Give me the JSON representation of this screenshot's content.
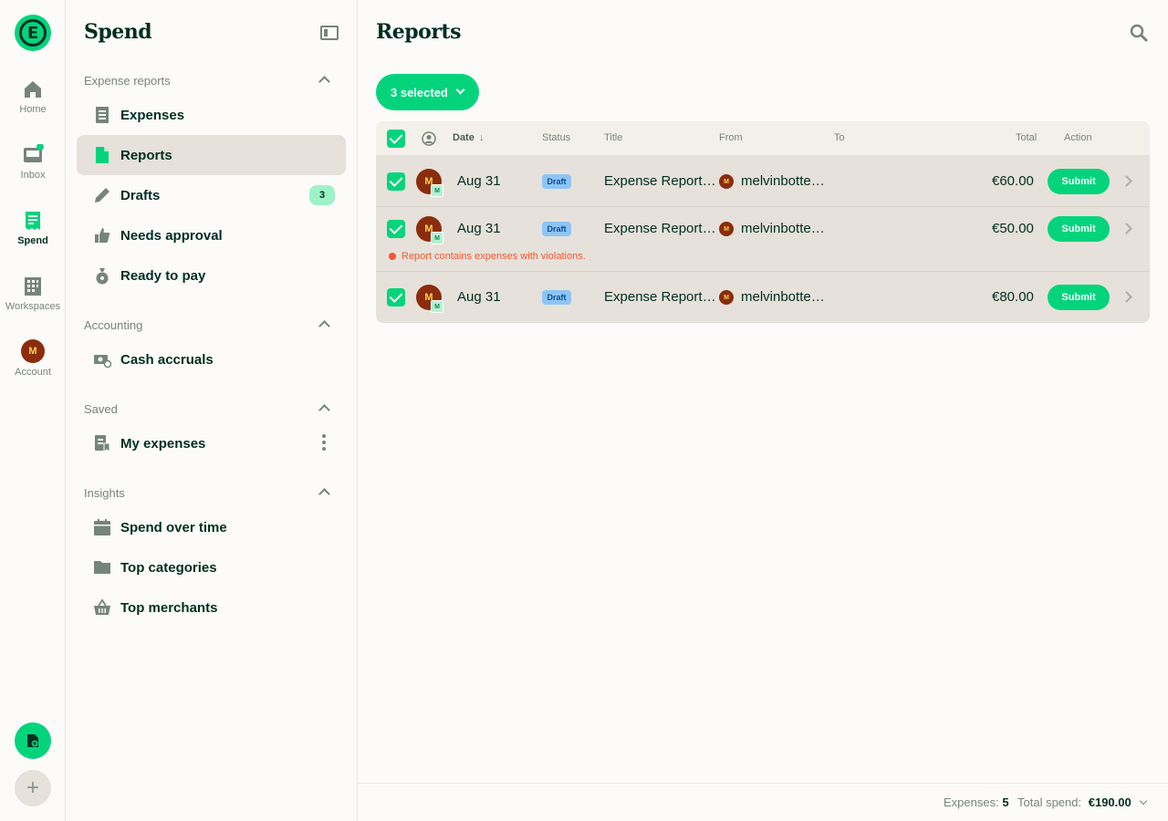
{
  "rail": {
    "items": [
      {
        "label": "Home",
        "icon": "home-icon"
      },
      {
        "label": "Inbox",
        "icon": "inbox-icon"
      },
      {
        "label": "Spend",
        "icon": "receipt-icon"
      },
      {
        "label": "Workspaces",
        "icon": "building-icon"
      },
      {
        "label": "Account",
        "icon": "avatar",
        "avatar_letter": "M"
      }
    ]
  },
  "sidebar": {
    "title": "Spend",
    "sections": [
      {
        "label": "Expense reports",
        "items": [
          {
            "label": "Expenses",
            "icon": "receipt-icon"
          },
          {
            "label": "Reports",
            "icon": "document-icon",
            "active": true
          },
          {
            "label": "Drafts",
            "icon": "pencil-icon",
            "badge": "3"
          },
          {
            "label": "Needs approval",
            "icon": "thumbs-up-icon"
          },
          {
            "label": "Ready to pay",
            "icon": "money-bag-icon"
          }
        ]
      },
      {
        "label": "Accounting",
        "items": [
          {
            "label": "Cash accruals",
            "icon": "cash-icon"
          }
        ]
      },
      {
        "label": "Saved",
        "items": [
          {
            "label": "My expenses",
            "icon": "bookmark-receipt-icon"
          }
        ]
      },
      {
        "label": "Insights",
        "items": [
          {
            "label": "Spend over time",
            "icon": "calendar-icon"
          },
          {
            "label": "Top categories",
            "icon": "folder-icon"
          },
          {
            "label": "Top merchants",
            "icon": "basket-icon"
          }
        ]
      }
    ]
  },
  "main": {
    "title": "Reports",
    "selected_button": "3 selected",
    "columns": {
      "date": "Date",
      "status": "Status",
      "title": "Title",
      "from": "From",
      "to": "To",
      "total": "Total",
      "action": "Action"
    },
    "rows": [
      {
        "avatar": "M",
        "mini": "M",
        "date": "Aug 31",
        "status": "Draft",
        "title": "Expense Report…",
        "from_avatar": "M",
        "from": "melvinbotte…",
        "total": "€60.00",
        "action": "Submit"
      },
      {
        "avatar": "M",
        "mini": "M",
        "date": "Aug 31",
        "status": "Draft",
        "title": "Expense Report…",
        "from_avatar": "M",
        "from": "melvinbotte…",
        "total": "€50.00",
        "action": "Submit",
        "violation": "Report contains expenses with violations."
      },
      {
        "avatar": "M",
        "mini": "M",
        "date": "Aug 31",
        "status": "Draft",
        "title": "Expense Report…",
        "from_avatar": "M",
        "from": "melvinbotte…",
        "total": "€80.00",
        "action": "Submit"
      }
    ]
  },
  "footer": {
    "expenses_label": "Expenses:",
    "expenses_count": "5",
    "total_label": "Total spend:",
    "total_value": "€190.00"
  },
  "colors": {
    "accent": "#03d47c",
    "text": "#002e22",
    "muted": "#76847e",
    "danger": "#f25730"
  }
}
